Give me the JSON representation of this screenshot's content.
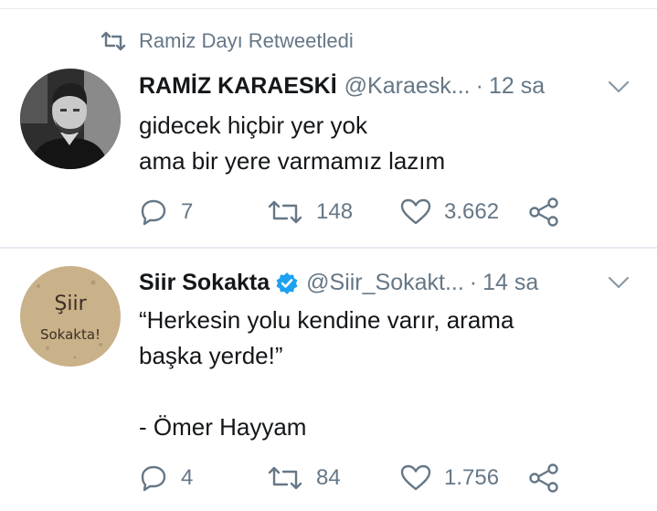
{
  "retweet_context": {
    "text": "Ramiz Dayı Retweetledi",
    "icon": "retweet-icon"
  },
  "tweets": [
    {
      "name": "RAMİZ KARAESKİ",
      "handle": "@Karaesk...",
      "separator": "·",
      "time": "12 sa",
      "lines": [
        "gidecek hiçbir yer yok",
        "ama bir yere varmamız lazım"
      ],
      "replies": "7",
      "retweets": "148",
      "likes": "3.662",
      "verified": false
    },
    {
      "name": "Siir Sokakta",
      "handle": "@Siir_Sokakt...",
      "separator": "·",
      "time": "14 sa",
      "lines": [
        "“Herkesin yolu kendine varır, arama",
        "başka yerde!”",
        "",
        "- Ömer Hayyam"
      ],
      "replies": "4",
      "retweets": "84",
      "likes": "1.756",
      "verified": true,
      "avatar_text": [
        "Şiir",
        "Sokakta!"
      ]
    }
  ],
  "colors": {
    "muted": "#657786",
    "text": "#14171a",
    "verified": "#1da1f2",
    "divider": "#e6ecf0"
  }
}
